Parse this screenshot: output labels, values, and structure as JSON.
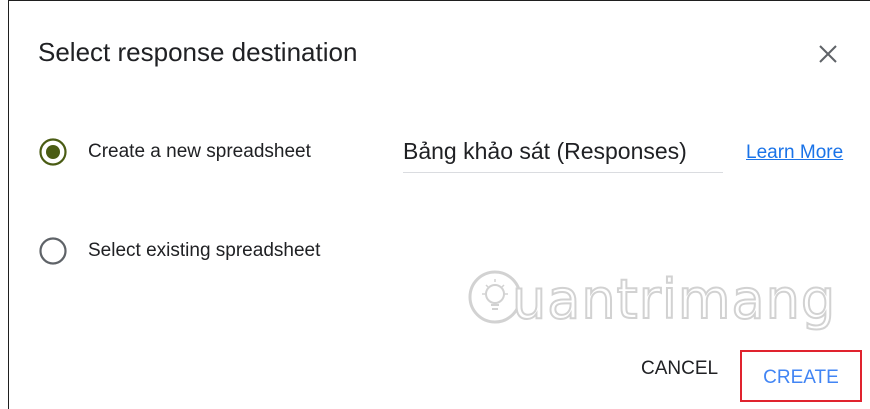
{
  "dialog": {
    "title": "Select response destination",
    "close_icon": "close-icon"
  },
  "options": [
    {
      "label": "Create a new spreadsheet",
      "selected": true,
      "icon": "radio-checked-icon"
    },
    {
      "label": "Select existing spreadsheet",
      "selected": false,
      "icon": "radio-unchecked-icon"
    }
  ],
  "spreadsheet_name": {
    "value": "Bảng khảo sát (Responses)"
  },
  "learn_more": "Learn More",
  "watermark": {
    "text": "uantrimang",
    "icon": "lightbulb-icon"
  },
  "actions": {
    "cancel": "CANCEL",
    "create": "CREATE"
  },
  "colors": {
    "radio_selected": "#4a5c14",
    "radio_unselected": "#5f6368",
    "link": "#1a73e8",
    "create_text": "#4285f4",
    "highlight_border": "#e0232e"
  }
}
